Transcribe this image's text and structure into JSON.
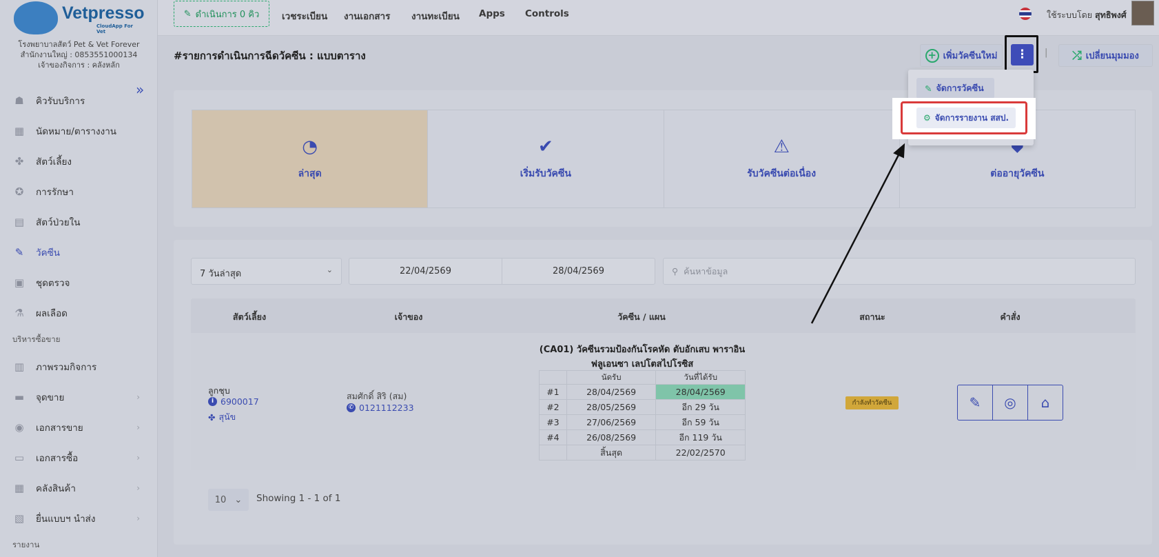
{
  "brand": {
    "name": "Vetpresso",
    "tagline": "CloudApp For Vet"
  },
  "clinic": {
    "line1": "โรงพยาบาลสัตว์ Pet & Vet Forever",
    "line2": "สำนักงานใหญ่ : 0853551000134",
    "line3": "เจ้าของกิจการ : คลังหลัก"
  },
  "sidebar": {
    "items": [
      {
        "label": "คิวรับบริการ",
        "icon": "queue-icon"
      },
      {
        "label": "นัดหมาย/ตารางงาน",
        "icon": "calendar-icon"
      },
      {
        "label": "สัตว์เลี้ยง",
        "icon": "paw-icon"
      },
      {
        "label": "การรักษา",
        "icon": "treatment-icon"
      },
      {
        "label": "สัตว์ป่วยใน",
        "icon": "ward-icon"
      },
      {
        "label": "วัคซีน",
        "icon": "syringe-icon",
        "active": true
      },
      {
        "label": "ชุดตรวจ",
        "icon": "test-kit-icon"
      },
      {
        "label": "ผลเลือด",
        "icon": "flask-icon"
      }
    ],
    "section_sales": "บริหารซื้อขาย",
    "sales_items": [
      {
        "label": "ภาพรวมกิจการ",
        "icon": "overview-icon"
      },
      {
        "label": "จุดขาย",
        "icon": "pos-icon"
      },
      {
        "label": "เอกสารขาย",
        "icon": "sales-doc-icon"
      },
      {
        "label": "เอกสารซื้อ",
        "icon": "purchase-doc-icon"
      },
      {
        "label": "คลังสินค้า",
        "icon": "warehouse-icon"
      },
      {
        "label": "ยื่นแบบฯ นำส่ง",
        "icon": "tax-form-icon"
      }
    ],
    "section_report": "รายงาน"
  },
  "topbar": {
    "queue_label": "ดำเนินการ 0 คิว",
    "menus": [
      "เวชระเบียน",
      "งานเอกสาร",
      "งานทะเบียน",
      "Apps",
      "Controls"
    ],
    "user_prefix": "ใช้ระบบโดย",
    "user_name": "สุทธิพงศ์"
  },
  "page": {
    "title": "#รายการดำเนินการฉีดวัคซีน : แบบตาราง",
    "add_vaccine_label": "เพิ่มวัคซีนใหม่",
    "switch_view_label": "เปลี่ยนมุมมอง"
  },
  "dropdown": {
    "manage_vaccine": "จัดการวัคซีน",
    "manage_report": "จัดการรายงาน สสป."
  },
  "tabs": [
    {
      "label": "ล่าสุด",
      "icon": "recent-icon"
    },
    {
      "label": "เริ่มรับวัคซีน",
      "icon": "check-icon"
    },
    {
      "label": "รับวัคซีนต่อเนื่อง",
      "icon": "warning-icon"
    },
    {
      "label": "ต่ออายุวัคซีน",
      "icon": "shield-icon"
    }
  ],
  "filters": {
    "range": "7 วันล่าสุด",
    "date_from": "22/04/2569",
    "date_to": "28/04/2569",
    "search_placeholder": "ค้นหาข้อมูล"
  },
  "table": {
    "headers": [
      "สัตว์เลี้ยง",
      "เจ้าของ",
      "วัคซีน / แผน",
      "สถานะ",
      "คำสั่ง"
    ],
    "row": {
      "pet_name": "ลูกชุบ",
      "pet_id": "6900017",
      "pet_type": "สุนัข",
      "owner_name": "สมศักดิ์ สิริ (สม)",
      "owner_phone": "0121112233",
      "vaccine_title": "(CA01) วัคซีนรวมป้องกันโรคหัด ตับอักเสบ พาราอินฟลูเอนซา เลปโตสไปโรซิส",
      "col_due": "นัดรับ",
      "col_received": "วันที่ได้รับ",
      "doses": [
        {
          "no": "#1",
          "due": "28/04/2569",
          "received": "28/04/2569"
        },
        {
          "no": "#2",
          "due": "28/05/2569",
          "received": "อีก 29 วัน"
        },
        {
          "no": "#3",
          "due": "27/06/2569",
          "received": "อีก 59 วัน"
        },
        {
          "no": "#4",
          "due": "26/08/2569",
          "received": "อีก 119 วัน"
        }
      ],
      "end_label": "สิ้นสุด",
      "end_date": "22/02/2570",
      "status": "กำลังทำวัคซีน"
    }
  },
  "pagination": {
    "page_size": "10",
    "showing": "Showing 1 - 1 of 1"
  },
  "colors": {
    "accent": "#3a4bb0",
    "green": "#2aa86d",
    "highlight_red": "#d93a3a"
  }
}
